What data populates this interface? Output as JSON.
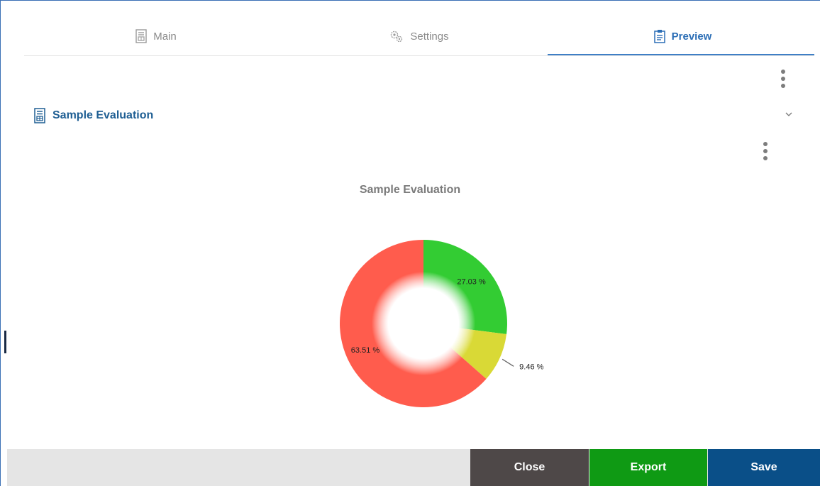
{
  "tabs": [
    {
      "label": "Main",
      "icon": "form-icon",
      "active": false
    },
    {
      "label": "Settings",
      "icon": "gears-icon",
      "active": false
    },
    {
      "label": "Preview",
      "icon": "clipboard-icon",
      "active": true
    }
  ],
  "section": {
    "title": "Sample Evaluation",
    "icon": "form-icon"
  },
  "chart_data": {
    "type": "pie",
    "variant": "donut",
    "title": "Sample Evaluation",
    "slices": [
      {
        "value": 27.03,
        "label": "27.03 %",
        "color": "#33cc33"
      },
      {
        "value": 9.46,
        "label": "9.46 %",
        "color": "#d9d936"
      },
      {
        "value": 63.51,
        "label": "63.51 %",
        "color": "#ff5c4d"
      }
    ],
    "legend": "none"
  },
  "footer": {
    "close_label": "Close",
    "export_label": "Export",
    "save_label": "Save"
  },
  "colors": {
    "accent": "#2a6db5",
    "close": "#4e4848",
    "export": "#0f9a14",
    "save": "#0a4f88"
  }
}
